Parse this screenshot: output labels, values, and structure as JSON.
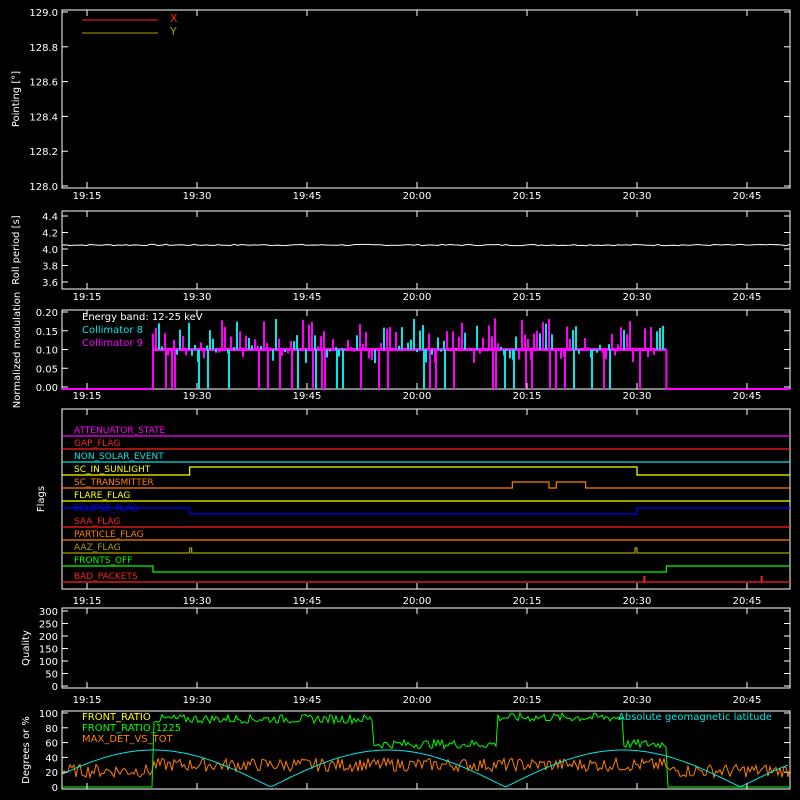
{
  "colors": {
    "bg": "#000000",
    "axis": "#ffffff",
    "red": "#ff2020",
    "olive": "#a8a000",
    "cyan": "#00e8e8",
    "magenta": "#ff00ff",
    "green": "#00ff00",
    "orange": "#ff8000",
    "yellow": "#ffff00",
    "blue": "#0000ff",
    "gold": "#e6b400"
  },
  "time_ticks": [
    "19:15",
    "19:30",
    "19:45",
    "20:00",
    "20:15",
    "20:30",
    "20:45"
  ],
  "chart_data": [
    {
      "id": "pointing",
      "type": "line",
      "ylabel": "Pointing [°]",
      "ylim": [
        128.0,
        129.0
      ],
      "yticks": [
        "129.0",
        "128.8",
        "128.6",
        "128.4",
        "128.2",
        "128.0"
      ],
      "series": [
        {
          "name": "X",
          "color": "#ff2020",
          "note": "no data visible in range"
        },
        {
          "name": "Y",
          "color": "#a8a000",
          "note": "no data visible in range"
        }
      ]
    },
    {
      "id": "roll",
      "type": "line",
      "ylabel": "Roll period [s]",
      "ylim": [
        3.5,
        4.5
      ],
      "yticks": [
        "4.4",
        "4.2",
        "4.0",
        "3.8",
        "3.6"
      ],
      "series": [
        {
          "value": 4.05
        }
      ]
    },
    {
      "id": "modulation",
      "type": "line",
      "ylabel": "Normalized modulation",
      "ylim": [
        0.0,
        0.2
      ],
      "yticks": [
        "0.20",
        "0.15",
        "0.10",
        "0.05",
        "0.00"
      ],
      "annotation": "Energy band: 12-25 keV",
      "series": [
        {
          "name": "Collimator 8",
          "color": "#00e8e8",
          "active_range": [
            "19:24",
            "20:34"
          ],
          "typical": 0.1
        },
        {
          "name": "Collimator 9",
          "color": "#ff00ff",
          "active_range": [
            "19:24",
            "20:34"
          ],
          "typical": 0.1
        }
      ]
    },
    {
      "id": "flags",
      "type": "line",
      "ylabel": "Flags",
      "flags": [
        {
          "label": "ATTENUATOR_STATE",
          "color": "#ff00ff"
        },
        {
          "label": "GAP_FLAG",
          "color": "#ff2020"
        },
        {
          "label": "NON_SOLAR_EVENT",
          "color": "#00e8e8"
        },
        {
          "label": "SC_IN_SUNLIGHT",
          "color": "#ffff00"
        },
        {
          "label": "SC_TRANSMITTER",
          "color": "#ff8000"
        },
        {
          "label": "FLARE_FLAG",
          "color": "#ffff00"
        },
        {
          "label": "ECLIPSE_FLAG",
          "color": "#0000ff"
        },
        {
          "label": "SAA_FLAG",
          "color": "#ff2020"
        },
        {
          "label": "PARTICLE_FLAG",
          "color": "#ff8000"
        },
        {
          "label": "AAZ_FLAG",
          "color": "#a8a000"
        },
        {
          "label": "FRONTS_OFF",
          "color": "#00ff00"
        },
        {
          "label": "BAD_PACKETS",
          "color": "#ff2020"
        }
      ]
    },
    {
      "id": "quality",
      "type": "line",
      "ylabel": "Quality",
      "ylim": [
        0,
        300
      ],
      "yticks": [
        "300",
        "250",
        "200",
        "150",
        "100",
        "50",
        "0"
      ]
    },
    {
      "id": "degrees",
      "type": "line",
      "ylabel": "Degrees or %",
      "ylim": [
        0,
        100
      ],
      "yticks": [
        "100",
        "80",
        "60",
        "40",
        "20",
        "0"
      ],
      "series": [
        {
          "name": "FRONT_RATIO",
          "color": "#ffff00"
        },
        {
          "name": "FRONT_RATIO_1225",
          "color": "#00ff00"
        },
        {
          "name": "MAX_DET_VS_TOT",
          "color": "#ff8000"
        },
        {
          "name": "Absolute geomagnetic latitude",
          "color": "#00e8e8"
        }
      ]
    }
  ]
}
